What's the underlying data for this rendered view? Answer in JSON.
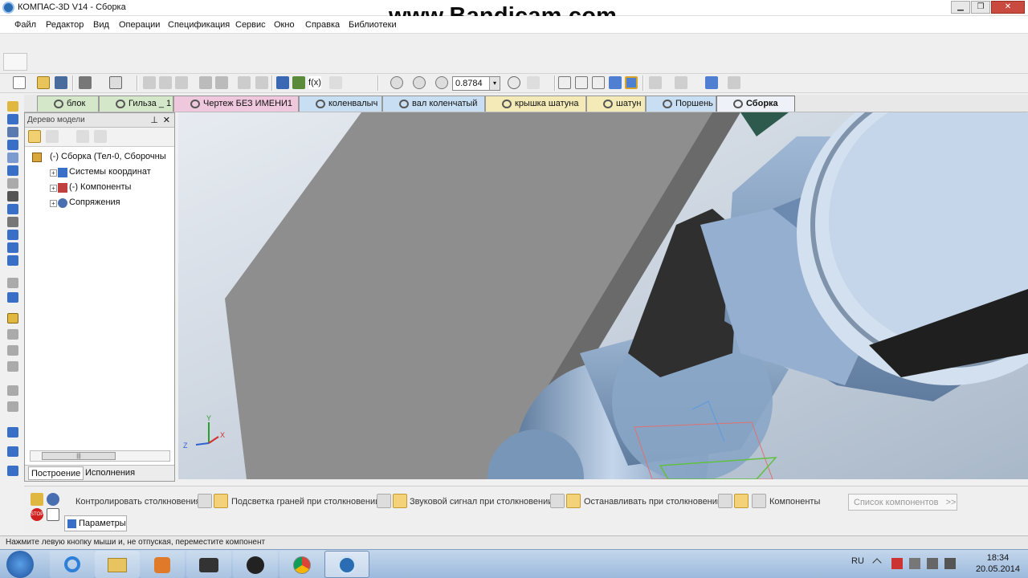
{
  "window": {
    "title": "КОМПАС-3D V14 - Сборка",
    "min": "▁",
    "max": "❐",
    "close": "✕"
  },
  "watermark": "www.Bandicam.com",
  "menu": [
    "Файл",
    "Редактор",
    "Вид",
    "Операции",
    "Спецификация",
    "Сервис",
    "Окно",
    "Справка",
    "Библиотеки"
  ],
  "toolbar": {
    "zoom_value": "0.8784",
    "dropdown": "▾"
  },
  "tabs": [
    {
      "label": "блок",
      "color": "#d4e7c8"
    },
    {
      "label": "Гильза _ 1",
      "color": "#d4e7c8"
    },
    {
      "label": "Чертеж БЕЗ ИМЕНИ1",
      "color": "#efc8de"
    },
    {
      "label": "коленвалыч",
      "color": "#c8def2"
    },
    {
      "label": "вал коленчатый",
      "color": "#c8def2"
    },
    {
      "label": "крышка шатуна",
      "color": "#f4eab8"
    },
    {
      "label": "шатун",
      "color": "#f4eab8"
    },
    {
      "label": "Поршень",
      "color": "#c8def2"
    },
    {
      "label": "Сборка",
      "color": "#eef2f8",
      "active": true
    }
  ],
  "tree": {
    "header": "Дерево модели",
    "pin": "⊥",
    "close": "✕",
    "root": "(-) Сборка (Тел-0, Сборочны",
    "items": [
      {
        "label": "Системы координат",
        "icon": "coordinate-systems-icon"
      },
      {
        "label": "(-) Компоненты",
        "icon": "components-icon"
      },
      {
        "label": "Сопряжения",
        "icon": "mates-icon"
      }
    ],
    "expand": "+",
    "scroll_grip": "|||",
    "tabs": [
      "Построение",
      "Исполнения"
    ]
  },
  "axes": {
    "x": "X",
    "y": "Y",
    "z": "Z"
  },
  "collision_panel": {
    "options": [
      "Контролировать столкновения",
      "Подсветка граней при столкновении",
      "Звуковой сигнал при столкновении",
      "Останавливать при столкновении",
      "Компоненты"
    ],
    "list_button": "Список компонентов",
    "list_arrow": ">>",
    "params_tab": "Параметры"
  },
  "status_text": "Нажмите левую кнопку мыши и, не отпуская, переместите компонент",
  "tray": {
    "lang": "RU",
    "time": "18:34",
    "date": "20.05.2014"
  }
}
